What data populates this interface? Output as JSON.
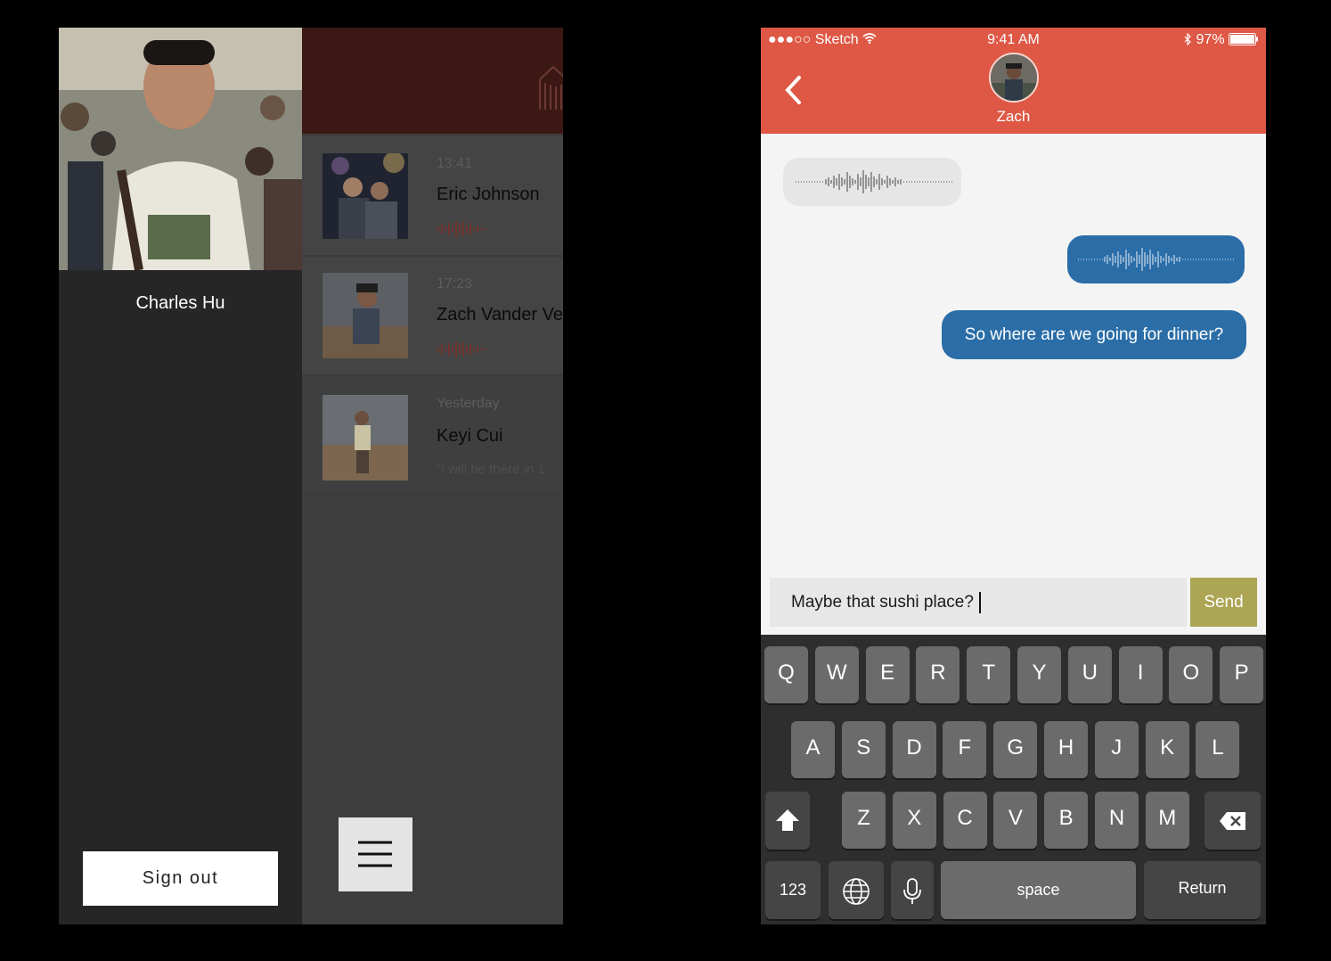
{
  "left_screen": {
    "drawer": {
      "user_name": "Charles Hu",
      "sign_out_label": "Sign out"
    },
    "conversations": [
      {
        "time": "13:41",
        "name": "Eric Johnson",
        "preview_type": "audio"
      },
      {
        "time": "17:23",
        "name": "Zach Vander Ve",
        "preview_type": "audio"
      },
      {
        "time": "Yesterday",
        "name": "Keyi Cui",
        "preview_text": "“I will be there in 1"
      }
    ],
    "menu_icon": "hamburger-icon"
  },
  "right_screen": {
    "status_bar": {
      "carrier": "●●●○○ Sketch",
      "time": "9:41 AM",
      "battery": "97%"
    },
    "header": {
      "contact_name": "Zach"
    },
    "messages": [
      {
        "type": "audio",
        "direction": "incoming"
      },
      {
        "type": "audio",
        "direction": "outgoing"
      },
      {
        "type": "text",
        "direction": "outgoing",
        "text": "So where are we going for dinner?"
      }
    ],
    "composer": {
      "value": "Maybe that sushi place?",
      "send_label": "Send"
    },
    "keyboard": {
      "row1": [
        "Q",
        "W",
        "E",
        "R",
        "T",
        "Y",
        "U",
        "I",
        "O",
        "P"
      ],
      "row2": [
        "A",
        "S",
        "D",
        "F",
        "G",
        "H",
        "J",
        "K",
        "L"
      ],
      "row3": [
        "Z",
        "X",
        "C",
        "V",
        "B",
        "N",
        "M"
      ],
      "numbers_label": "123",
      "space_label": "space",
      "return_label": "Return"
    }
  },
  "colors": {
    "header_red": "#de5845",
    "bubble_blue": "#2a6da7",
    "send_olive": "#aca654",
    "dark_header": "#3c1814"
  }
}
